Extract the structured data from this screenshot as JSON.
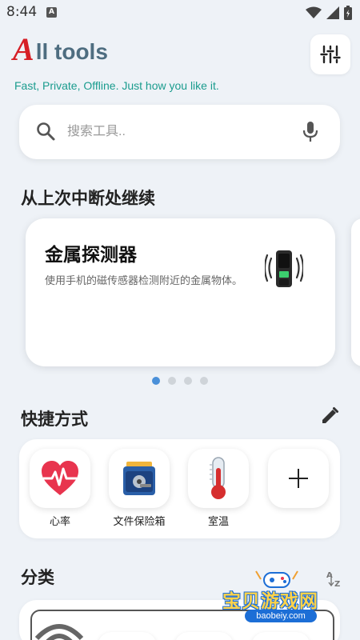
{
  "status_bar": {
    "time": "8:44",
    "notification_badge": "A",
    "icons": [
      "wifi-icon",
      "signal-icon",
      "battery-icon"
    ]
  },
  "header": {
    "title_first_letter": "A",
    "title_rest": "ll tools",
    "tagline": "Fast, Private, Offline. Just how you like it.",
    "settings_icon": "sliders-icon"
  },
  "search": {
    "placeholder": "搜索工具..",
    "value": "",
    "icon": "search-icon",
    "voice_icon": "mic-icon"
  },
  "continue_section": {
    "title": "从上次中断处继续",
    "card": {
      "title": "金属探测器",
      "description": "使用手机的磁传感器检测附近的金属物体。",
      "icon": "metal-detector-icon"
    },
    "pagination": {
      "count": 4,
      "active_index": 0
    }
  },
  "shortcuts_section": {
    "title": "快捷方式",
    "edit_icon": "pencil-icon",
    "items": [
      {
        "label": "心率",
        "icon": "heart-rate-icon"
      },
      {
        "label": "文件保险箱",
        "icon": "file-vault-icon"
      },
      {
        "label": "室温",
        "icon": "thermometer-icon"
      },
      {
        "label": "",
        "icon": "plus-icon"
      }
    ]
  },
  "categories_section": {
    "title": "分类",
    "sort_icon": "sort-az-icon"
  },
  "watermark": {
    "title": "宝贝游戏网",
    "url": "baobeiy.com"
  },
  "colors": {
    "accent": "#4a90d9",
    "brand_red": "#d61f26",
    "tagline": "#1a9c8e",
    "background": "#eef2f7"
  }
}
